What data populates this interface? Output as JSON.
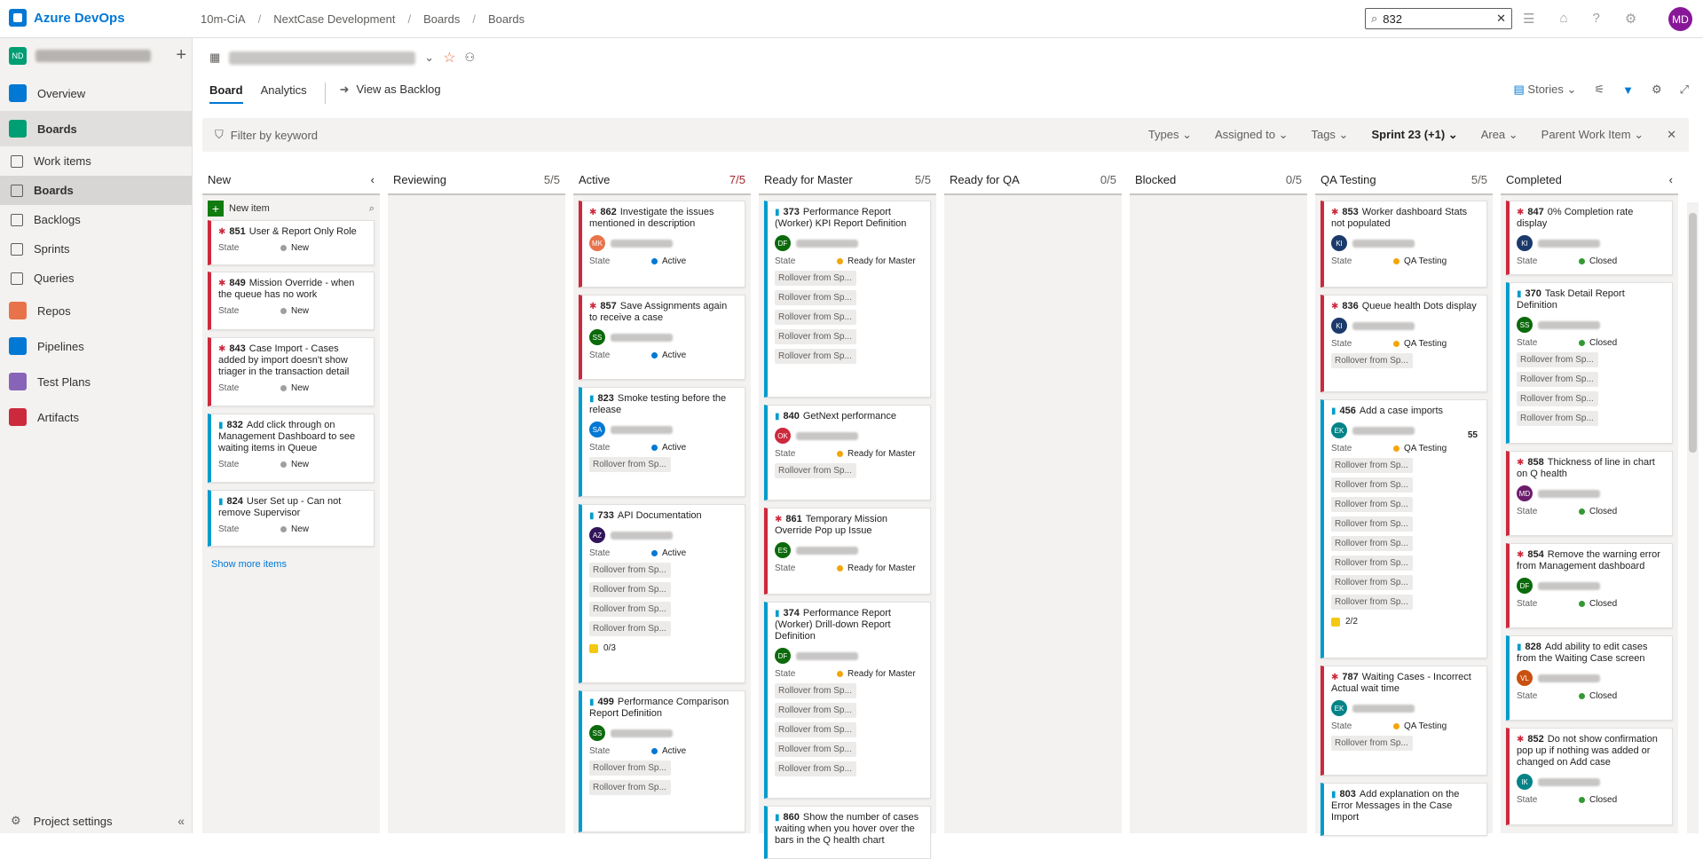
{
  "app": {
    "name": "Azure DevOps",
    "user_initials": "MD"
  },
  "breadcrumb": [
    "10m-CiA",
    "NextCase Development",
    "Boards",
    "Boards"
  ],
  "search": {
    "value": "832"
  },
  "sidebar": {
    "project_initials": "ND",
    "items": [
      {
        "label": "Overview",
        "color": "#0078d4"
      },
      {
        "label": "Boards",
        "color": "#009e73"
      },
      {
        "label": "Repos",
        "color": "#e8734a"
      },
      {
        "label": "Pipelines",
        "color": "#0078d4"
      },
      {
        "label": "Test Plans",
        "color": "#8764b8"
      },
      {
        "label": "Artifacts",
        "color": "#cc293d"
      }
    ],
    "sub_items": [
      "Work items",
      "Boards",
      "Backlogs",
      "Sprints",
      "Queries"
    ],
    "project_settings": "Project settings"
  },
  "header": {
    "tabs": [
      "Board",
      "Analytics"
    ],
    "view_backlog": "View as Backlog",
    "backlog_level": "Stories"
  },
  "filterbar": {
    "placeholder": "Filter by keyword",
    "pills": [
      "Types",
      "Assigned to",
      "Tags",
      "Sprint 23 (+1)",
      "Area",
      "Parent Work Item"
    ]
  },
  "board": {
    "state_label": "State",
    "rollover": "Rollover from Sp...",
    "new_item": "New item",
    "show_more": "Show more items",
    "columns": [
      {
        "name": "New",
        "count": ""
      },
      {
        "name": "Reviewing",
        "count": "5/5"
      },
      {
        "name": "Active",
        "count": "7/5"
      },
      {
        "name": "Ready for Master",
        "count": "5/5"
      },
      {
        "name": "Ready for QA",
        "count": "0/5"
      },
      {
        "name": "Blocked",
        "count": "0/5"
      },
      {
        "name": "QA Testing",
        "count": "5/5"
      },
      {
        "name": "Completed",
        "count": ""
      }
    ],
    "cards": {
      "new": [
        {
          "id": "851",
          "title": "User & Report Only Role",
          "state": "New"
        },
        {
          "id": "849",
          "title": "Mission Override - when the queue has no work",
          "state": "New"
        },
        {
          "id": "843",
          "title": "Case Import - Cases added by import doesn't show triager in the transaction detail",
          "state": "New"
        },
        {
          "id": "832",
          "title": "Add click through on Management Dashboard to see waiting items in Queue",
          "state": "New"
        },
        {
          "id": "824",
          "title": "User Set up - Can not remove Supervisor",
          "state": "New"
        }
      ],
      "active": [
        {
          "id": "862",
          "title": "Investigate the issues mentioned in description",
          "initials": "MK",
          "state": "Active"
        },
        {
          "id": "857",
          "title": "Save Assignments again to receive a case",
          "initials": "SS",
          "state": "Active"
        },
        {
          "id": "823",
          "title": "Smoke testing before the release",
          "initials": "SA",
          "state": "Active"
        },
        {
          "id": "733",
          "title": "API Documentation",
          "initials": "AZ",
          "state": "Active",
          "tasks": "0/3"
        },
        {
          "id": "499",
          "title": "Performance Comparison Report Definition",
          "initials": "SS",
          "state": "Active"
        }
      ],
      "master": [
        {
          "id": "373",
          "title": "Performance Report (Worker) KPI Report Definition",
          "initials": "DF",
          "state": "Ready for Master"
        },
        {
          "id": "840",
          "title": "GetNext performance",
          "initials": "OK",
          "state": "Ready for Master"
        },
        {
          "id": "861",
          "title": "Temporary Mission Override Pop up Issue",
          "initials": "ES",
          "state": "Ready for Master"
        },
        {
          "id": "374",
          "title": "Performance Report (Worker) Drill-down Report Definition",
          "initials": "DF",
          "state": "Ready for Master"
        },
        {
          "id": "860",
          "title": "Show the number of cases waiting when you hover over the bars in the Q health chart"
        }
      ],
      "qa": [
        {
          "id": "853",
          "title": "Worker dashboard Stats not populated",
          "initials": "KI",
          "state": "QA Testing"
        },
        {
          "id": "836",
          "title": "Queue health Dots display",
          "initials": "KI",
          "state": "QA Testing"
        },
        {
          "id": "456",
          "title": "Add a case imports",
          "initials": "EK",
          "state": "QA Testing",
          "effort": "55",
          "tasks": "2/2"
        },
        {
          "id": "787",
          "title": "Waiting Cases - Incorrect Actual wait time",
          "initials": "EK",
          "state": "QA Testing"
        },
        {
          "id": "803",
          "title": "Add explanation on the Error Messages in the Case Import"
        }
      ],
      "completed": [
        {
          "id": "847",
          "title": "0% Completion rate display",
          "initials": "KI",
          "state": "Closed"
        },
        {
          "id": "370",
          "title": "Task Detail Report Definition",
          "initials": "SS",
          "state": "Closed"
        },
        {
          "id": "858",
          "title": "Thickness of line in chart on Q health",
          "initials": "MD",
          "state": "Closed"
        },
        {
          "id": "854",
          "title": "Remove the warning error from Management dashboard",
          "initials": "DF",
          "state": "Closed"
        },
        {
          "id": "828",
          "title": "Add ability to edit cases from the Waiting Case screen",
          "initials": "VL",
          "state": "Closed"
        },
        {
          "id": "852",
          "title": "Do not show confirmation pop up if nothing was added or changed on Add case",
          "initials": "IK",
          "state": "Closed"
        }
      ]
    }
  }
}
